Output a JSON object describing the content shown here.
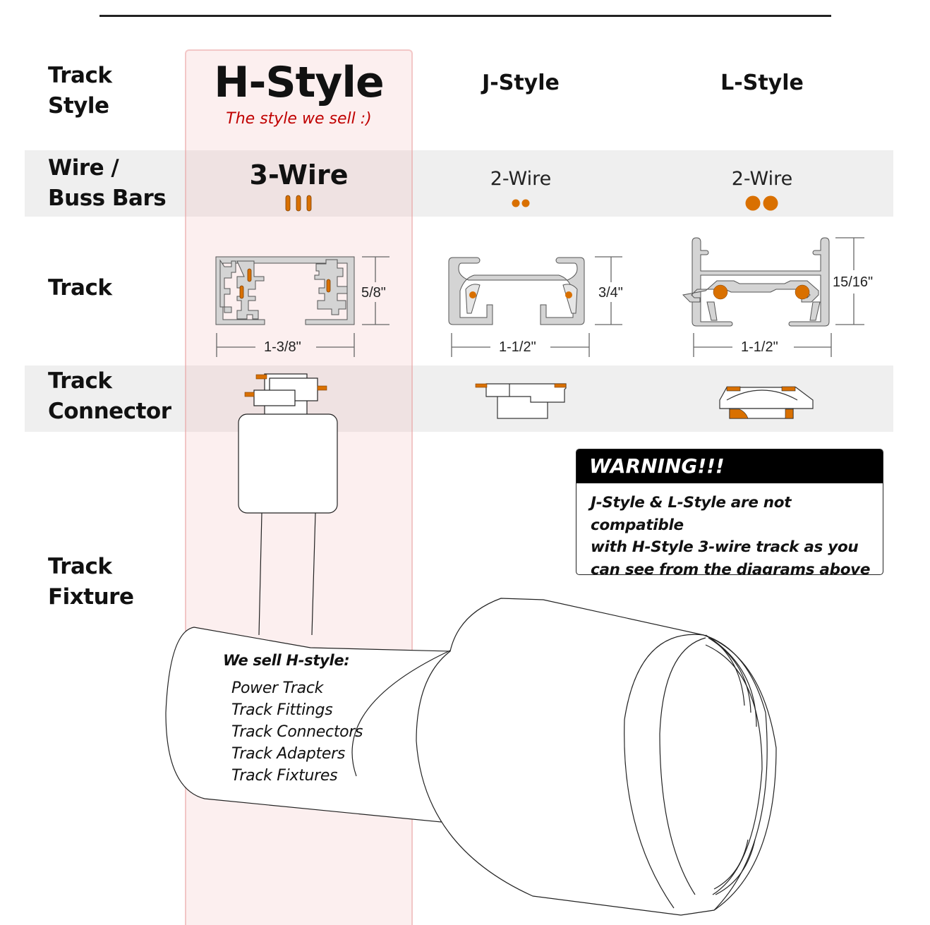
{
  "row_labels": {
    "track_style": [
      "Track",
      "Style"
    ],
    "wire": [
      "Wire /",
      "Buss Bars"
    ],
    "track": "Track",
    "connector": [
      "Track",
      "Connector"
    ],
    "fixture": [
      "Track",
      "Fixture"
    ]
  },
  "columns": [
    {
      "key": "h",
      "title": "H-Style",
      "subtitle": "The style we sell :)",
      "wires": "3-Wire",
      "buss_bar_count": 3,
      "buss_bar_shape": "bar",
      "width_dim": "1-3/8\"",
      "height_dim": "5/8\"",
      "highlighted": true
    },
    {
      "key": "j",
      "title": "J-Style",
      "wires": "2-Wire",
      "buss_bar_count": 2,
      "buss_bar_shape": "small-dot",
      "width_dim": "1-1/2\"",
      "height_dim": "3/4\"",
      "highlighted": false
    },
    {
      "key": "l",
      "title": "L-Style",
      "wires": "2-Wire",
      "buss_bar_count": 2,
      "buss_bar_shape": "large-dot",
      "width_dim": "1-1/2\"",
      "height_dim": "15/16\"",
      "highlighted": false
    }
  ],
  "warning": {
    "title": "WARNING!!!",
    "lines": [
      "J-Style & L-Style are not compatible",
      "with H-Style 3-wire track as you",
      "can see from the diagrams above :("
    ]
  },
  "we_sell": {
    "title": "We sell H-style:",
    "items": [
      "Power Track",
      "Track Fittings",
      "Track Connectors",
      "Track Adapters",
      "Track Fixtures"
    ]
  },
  "colors": {
    "accent_orange": "#d97000",
    "subtitle_red": "#c00000",
    "band_gray": "#efefef",
    "highlight_pink": "#f6dada",
    "track_gray": "#d4d4d4"
  }
}
